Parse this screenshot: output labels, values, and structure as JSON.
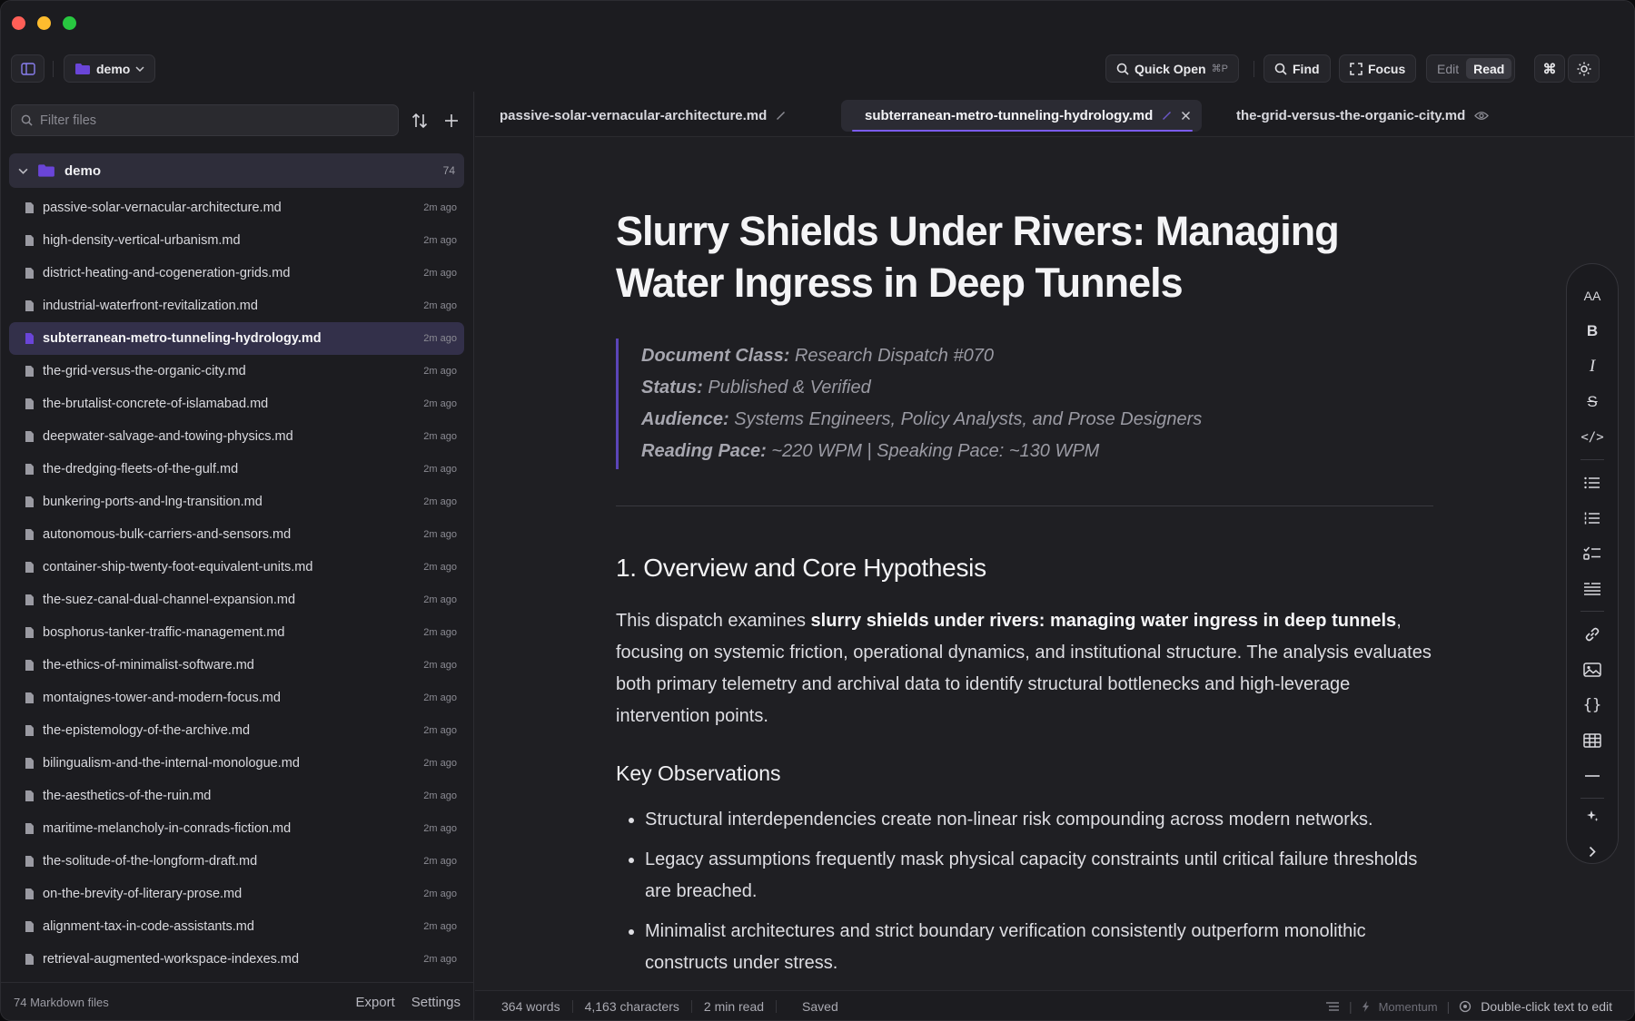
{
  "window": {
    "title": ""
  },
  "toolbar": {
    "folder_label": "demo",
    "quick_open_label": "Quick Open",
    "quick_open_shortcut": "⌘P",
    "find_label": "Find",
    "focus_label": "Focus",
    "mode_edit": "Edit",
    "mode_read": "Read",
    "mode_selected": "Read",
    "command_symbol": "⌘"
  },
  "sidebar": {
    "filter_placeholder": "Filter files",
    "folder": {
      "name": "demo",
      "count": "74"
    },
    "files": [
      {
        "name": "passive-solar-vernacular-architecture.md",
        "ago": "2m ago"
      },
      {
        "name": "high-density-vertical-urbanism.md",
        "ago": "2m ago"
      },
      {
        "name": "district-heating-and-cogeneration-grids.md",
        "ago": "2m ago"
      },
      {
        "name": "industrial-waterfront-revitalization.md",
        "ago": "2m ago"
      },
      {
        "name": "subterranean-metro-tunneling-hydrology.md",
        "ago": "2m ago",
        "active": true
      },
      {
        "name": "the-grid-versus-the-organic-city.md",
        "ago": "2m ago"
      },
      {
        "name": "the-brutalist-concrete-of-islamabad.md",
        "ago": "2m ago"
      },
      {
        "name": "deepwater-salvage-and-towing-physics.md",
        "ago": "2m ago"
      },
      {
        "name": "the-dredging-fleets-of-the-gulf.md",
        "ago": "2m ago"
      },
      {
        "name": "bunkering-ports-and-lng-transition.md",
        "ago": "2m ago"
      },
      {
        "name": "autonomous-bulk-carriers-and-sensors.md",
        "ago": "2m ago"
      },
      {
        "name": "container-ship-twenty-foot-equivalent-units.md",
        "ago": "2m ago"
      },
      {
        "name": "the-suez-canal-dual-channel-expansion.md",
        "ago": "2m ago"
      },
      {
        "name": "bosphorus-tanker-traffic-management.md",
        "ago": "2m ago"
      },
      {
        "name": "the-ethics-of-minimalist-software.md",
        "ago": "2m ago"
      },
      {
        "name": "montaignes-tower-and-modern-focus.md",
        "ago": "2m ago"
      },
      {
        "name": "the-epistemology-of-the-archive.md",
        "ago": "2m ago"
      },
      {
        "name": "bilingualism-and-the-internal-monologue.md",
        "ago": "2m ago"
      },
      {
        "name": "the-aesthetics-of-the-ruin.md",
        "ago": "2m ago"
      },
      {
        "name": "maritime-melancholy-in-conrads-fiction.md",
        "ago": "2m ago"
      },
      {
        "name": "the-solitude-of-the-longform-draft.md",
        "ago": "2m ago"
      },
      {
        "name": "on-the-brevity-of-literary-prose.md",
        "ago": "2m ago"
      },
      {
        "name": "alignment-tax-in-code-assistants.md",
        "ago": "2m ago"
      },
      {
        "name": "retrieval-augmented-workspace-indexes.md",
        "ago": "2m ago"
      }
    ],
    "footer_count": "74 Markdown files",
    "export_label": "Export",
    "settings_label": "Settings"
  },
  "tabs": [
    {
      "label": "passive-solar-vernacular-architecture.md",
      "icon": "pencil-icon"
    },
    {
      "label": "subterranean-metro-tunneling-hydrology.md",
      "icon": "pencil-icon",
      "active": true
    },
    {
      "label": "the-grid-versus-the-organic-city.md",
      "icon": "eye-icon"
    }
  ],
  "document": {
    "title": "Slurry Shields Under Rivers: Managing Water Ingress in Deep Tunnels",
    "meta": [
      {
        "key": "Document Class:",
        "value": "Research Dispatch #070"
      },
      {
        "key": "Status:",
        "value": "Published & Verified"
      },
      {
        "key": "Audience:",
        "value": "Systems Engineers, Policy Analysts, and Prose Designers"
      },
      {
        "key": "Reading Pace:",
        "value": "~220 WPM | Speaking Pace: ~130 WPM"
      }
    ],
    "section_heading": "1. Overview and Core Hypothesis",
    "para_prefix": "This dispatch examines ",
    "para_bold": "slurry shields under rivers: managing water ingress in deep tunnels",
    "para_suffix": ", focusing on systemic friction, operational dynamics, and institutional structure. The analysis evaluates both primary telemetry and archival data to identify structural bottlenecks and high-leverage intervention points.",
    "sub_heading": "Key Observations",
    "bullets": [
      "Structural interdependencies create non-linear risk compounding across modern networks.",
      "Legacy assumptions frequently mask physical capacity constraints until critical failure thresholds are breached.",
      "Minimalist architectures and strict boundary verification consistently outperform monolithic constructs under stress."
    ]
  },
  "format_toolbar": {
    "items": [
      "text-size-icon",
      "bold-icon",
      "italic-icon",
      "strikethrough-icon",
      "code-icon",
      "bullet-list-icon",
      "numbered-list-icon",
      "task-list-icon",
      "blockquote-icon",
      "link-icon",
      "image-icon",
      "code-block-icon",
      "table-icon",
      "horizontal-rule-icon",
      "ai-sparkle-icon",
      "chevron-right-icon"
    ],
    "text_size_label": "AA",
    "bold_label": "B",
    "italic_label": "I",
    "strike_label": "S",
    "code_label": "</>",
    "code_block_label": "{}"
  },
  "status_bar": {
    "words": "364 words",
    "characters": "4,163 characters",
    "read_time": "2 min read",
    "save_state": "Saved",
    "momentum": "Momentum",
    "hint": "Double-click text to edit"
  },
  "colors": {
    "accent": "#7b5cf0",
    "background": "#1f1f23",
    "sidebar": "#1c1c20"
  }
}
